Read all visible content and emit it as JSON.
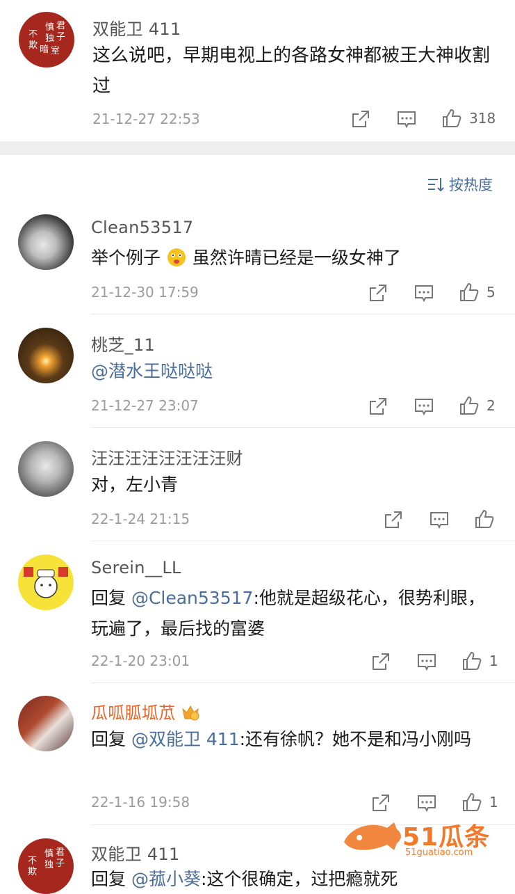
{
  "sort_label": "按热度",
  "comments": [
    {
      "user": "双能卫 411",
      "text": "这么说吧，早期电视上的各路女神都被王大神收割过",
      "time": "21-12-27 22:53",
      "likes": "318"
    },
    {
      "user": "Clean53517",
      "text_a": "举个例子",
      "text_b": "虽然许晴已经是一级女神了",
      "time": "21-12-30 17:59",
      "likes": "5"
    },
    {
      "user": "桃芝_11",
      "text": "@潜水王哒哒哒",
      "time": "21-12-27 23:07",
      "likes": "2"
    },
    {
      "user": "汪汪汪汪汪汪汪汪财",
      "text": "对，左小青",
      "time": "22-1-24 21:15",
      "likes": ""
    },
    {
      "user": "Serein__LL",
      "reply_prefix": "回复 ",
      "mention": "@Clean53517",
      "text": ":他就是超级花心，很势利眼，玩遍了，最后找的富婆",
      "time": "22-1-20 23:01",
      "likes": "1"
    },
    {
      "user": "瓜呱胍坬苽",
      "reply_prefix": "回复 ",
      "mention": "@双能卫 411",
      "text": ":还有徐帆？她不是和冯小刚吗",
      "time": "22-1-16 19:58",
      "likes": "1"
    },
    {
      "user": "双能卫 411",
      "reply_prefix": "回复 ",
      "mention": "@菰小葵",
      "text": ":这个很确定，过把瘾就死"
    }
  ],
  "seal_text": "君子慎独 不欺暗室",
  "watermark": {
    "brand": "51瓜条",
    "url": "51guatiao.com"
  },
  "colors": {
    "mention": "#4a6d9b",
    "vip_name": "#e8662a",
    "watermark": "#f07a2a"
  },
  "icons": [
    "share-icon",
    "comment-icon",
    "like-icon",
    "sort-icon",
    "crown-icon"
  ]
}
